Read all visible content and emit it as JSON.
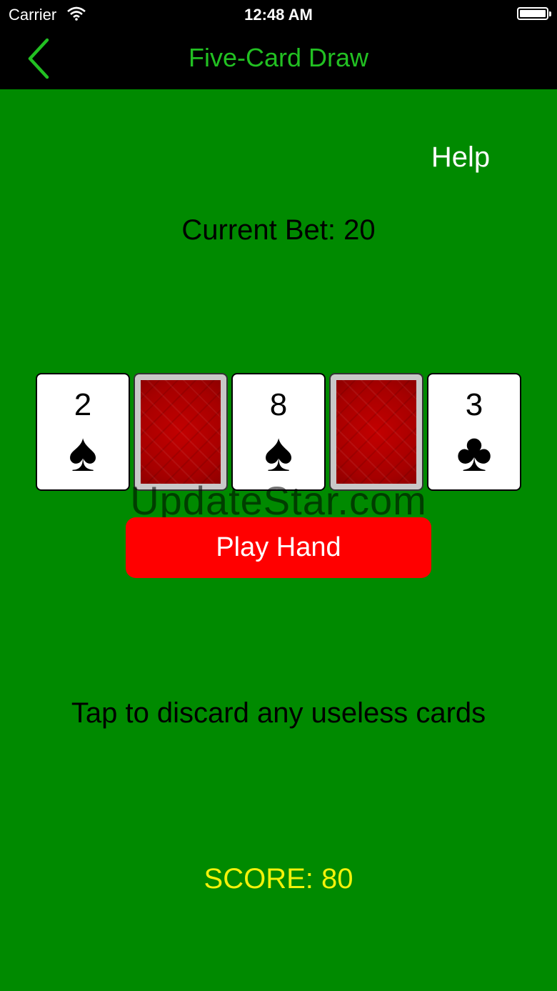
{
  "status_bar": {
    "carrier": "Carrier",
    "time": "12:48 AM"
  },
  "nav": {
    "title": "Five-Card Draw",
    "back_icon": "chevron-left-icon",
    "title_color": "#22c022"
  },
  "help_label": "Help",
  "current_bet": "Current Bet: 20",
  "cards": [
    {
      "rank": "2",
      "suit": "♠",
      "face_up": true
    },
    {
      "rank": "",
      "suit": "",
      "face_up": false
    },
    {
      "rank": "8",
      "suit": "♠",
      "face_up": true
    },
    {
      "rank": "",
      "suit": "",
      "face_up": false
    },
    {
      "rank": "3",
      "suit": "♣",
      "face_up": true
    }
  ],
  "watermark": "UpdateStar.com",
  "play_button": {
    "label": "Play Hand",
    "color": "#ff0000"
  },
  "instruction": "Tap to discard any useless cards",
  "score": "SCORE: 80",
  "colors": {
    "table": "#008a00",
    "score": "#f2f20a"
  }
}
